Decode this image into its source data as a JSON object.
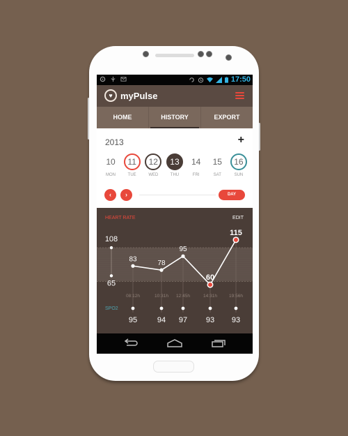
{
  "status_bar": {
    "left_icons": [
      "android-debug-icon",
      "usb-icon",
      "mail-icon"
    ],
    "right_icons": [
      "sync-icon",
      "alarm-icon",
      "wifi-icon",
      "signal-icon",
      "battery-icon"
    ],
    "time": "17:50"
  },
  "app_bar": {
    "title": "myPulse",
    "logo_icon": "heart-icon",
    "menu_icon": "hamburger-menu-icon"
  },
  "tabs": [
    {
      "label": "HOME",
      "active": false
    },
    {
      "label": "HISTORY",
      "active": true
    },
    {
      "label": "EXPORT",
      "active": false
    }
  ],
  "calendar": {
    "year": "2013",
    "add_label": "+",
    "days": [
      {
        "num": "10",
        "label": "MON",
        "style": "plain"
      },
      {
        "num": "11",
        "label": "TUE",
        "style": "red"
      },
      {
        "num": "12",
        "label": "WED",
        "style": "brown"
      },
      {
        "num": "13",
        "label": "THU",
        "style": "filled"
      },
      {
        "num": "14",
        "label": "FRI",
        "style": "plain"
      },
      {
        "num": "15",
        "label": "SAT",
        "style": "plain"
      },
      {
        "num": "16",
        "label": "SUN",
        "style": "teal"
      }
    ],
    "prev_label": "‹",
    "next_label": "›",
    "period_label": "DAY"
  },
  "chart_data": {
    "type": "line",
    "title": "HEART RATE",
    "edit_label": "EDIT",
    "range": {
      "max": 108,
      "min": 65
    },
    "x": [
      "08:12h",
      "10:31h",
      "12:45h",
      "14:31h",
      "19:56h"
    ],
    "series": [
      {
        "name": "Heart Rate",
        "values": [
          83,
          78,
          95,
          60,
          115
        ]
      }
    ],
    "highlighted": [
      60,
      115
    ],
    "secondary": {
      "name": "SPO2",
      "values": [
        95,
        94,
        97,
        93,
        93
      ]
    },
    "ylim": [
      55,
      120
    ],
    "colors": {
      "line": "#ffffff",
      "alert": "#e8483b",
      "spo2": "#4ea3b0"
    }
  },
  "nav_bar": {
    "icons": [
      "back-icon",
      "home-icon",
      "recent-apps-icon"
    ]
  }
}
